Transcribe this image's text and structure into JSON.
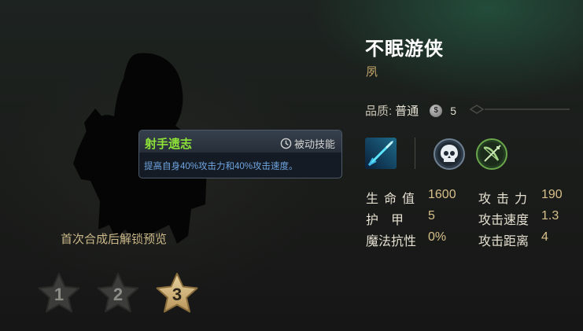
{
  "hero": {
    "name": "不眠游侠",
    "subtitle": "夙",
    "quality_label": "品质:",
    "quality_value": "普通",
    "coin_symbol": "$",
    "cost": "5"
  },
  "skill": {
    "name": "射手遗志",
    "type": "被动技能",
    "description": "提高自身40%攻击力和40%攻击速度。",
    "icon": "arrow-skill-icon"
  },
  "traits": [
    {
      "icon": "skull-icon",
      "color": "#3a4a5a"
    },
    {
      "icon": "crossbow-icon",
      "color": "#2f5a2a"
    }
  ],
  "stats": {
    "left": [
      {
        "label": "生命值",
        "value": "1600"
      },
      {
        "label": "护　甲",
        "value": "5"
      },
      {
        "label": "魔法抗性",
        "value": "0%"
      }
    ],
    "right": [
      {
        "label": "攻击力",
        "value": "190"
      },
      {
        "label": "攻击速度",
        "value": "1.3"
      },
      {
        "label": "攻击距离",
        "value": "4"
      }
    ]
  },
  "unlock_text": "首次合成后解锁预览",
  "stars": [
    {
      "label": "1",
      "state": "inactive"
    },
    {
      "label": "2",
      "state": "inactive"
    },
    {
      "label": "3",
      "state": "active"
    }
  ],
  "colors": {
    "skill_name": "#8ee238",
    "description": "#6fa5e0",
    "star_active": "#d8c08a"
  }
}
